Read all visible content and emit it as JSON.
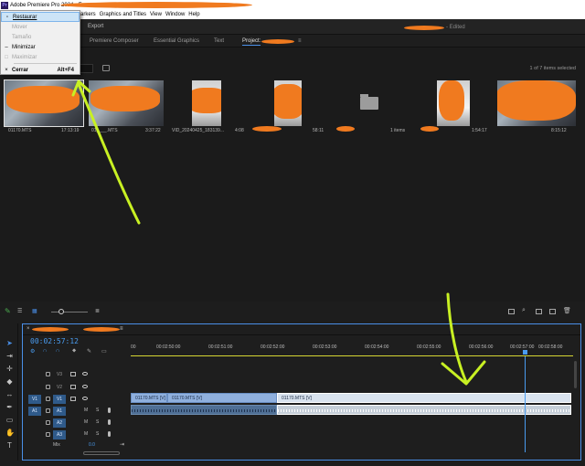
{
  "window": {
    "app_title": "Adobe Premiere Pro 2024 - F",
    "app_icon": "Pr"
  },
  "menubar": {
    "items": [
      "arkers",
      "Graphics and Titles",
      "View",
      "Window",
      "Help"
    ]
  },
  "workspace": {
    "export_label": "Export",
    "edited_label": "- Edited"
  },
  "panel_tabs": [
    "Premiere Composer",
    "Essential Graphics",
    "Text",
    "Project:"
  ],
  "panel_menu_icon": "hamburger-menu-icon",
  "context_menu": {
    "items": [
      {
        "label": "Restaurar",
        "icon": "restore-icon",
        "shortcut": "",
        "enabled": true,
        "highlighted": true
      },
      {
        "label": "Mover",
        "icon": "",
        "shortcut": "",
        "enabled": false,
        "highlighted": false
      },
      {
        "label": "Tamaño",
        "icon": "",
        "shortcut": "",
        "enabled": false,
        "highlighted": false
      },
      {
        "label": "Minimizar",
        "icon": "minimize-icon",
        "shortcut": "",
        "enabled": true,
        "highlighted": false
      },
      {
        "label": "Maximizar",
        "icon": "maximize-icon",
        "shortcut": "",
        "enabled": false,
        "highlighted": false
      },
      {
        "label": "Cerrar",
        "icon": "close-icon",
        "shortcut": "Alt+F4",
        "enabled": true,
        "highlighted": false
      }
    ]
  },
  "project": {
    "items_selected": "1 of 7 items selected",
    "thumbnails": [
      {
        "name": "01170.MTS",
        "duration": "17:13:19"
      },
      {
        "name": "01____.MTS",
        "duration": "3:37:22"
      },
      {
        "name": "VID_20240425_183139...",
        "duration": "4:08"
      },
      {
        "name": "",
        "duration": "58:11"
      },
      {
        "name": "",
        "duration": "1 items"
      },
      {
        "name": "",
        "duration": "1:54:17"
      },
      {
        "name": "",
        "duration": "8:15:12"
      }
    ]
  },
  "timeline": {
    "timecode": "00:02:57:12",
    "ruler_ticks": [
      "00",
      "00:02:50:00",
      "00:02:51:00",
      "00:02:52:00",
      "00:02:53:00",
      "00:02:54:00",
      "00:02:55:00",
      "00:02:56:00",
      "00:02:57:00",
      "00:02:58:00"
    ],
    "tracks": [
      {
        "src": "",
        "name": "V3",
        "type": "video"
      },
      {
        "src": "",
        "name": "V2",
        "type": "video"
      },
      {
        "src": "V1",
        "name": "V1",
        "type": "video"
      },
      {
        "src": "A1",
        "name": "A1",
        "type": "audio"
      },
      {
        "src": "",
        "name": "A2",
        "type": "audio"
      },
      {
        "src": "",
        "name": "A3",
        "type": "audio"
      }
    ],
    "audio_labels": {
      "m": "M",
      "s": "S"
    },
    "clips": {
      "v1_a": "01170.MTS [V]",
      "v1_b": "01170.MTS [V]",
      "v1_c": "01170.MTS [V]"
    },
    "mix_label": "Mix",
    "mix_value": "0.0"
  },
  "colors": {
    "accent": "#4a8fe7",
    "redaction": "#f07a1f",
    "annotation": "#c8f023"
  }
}
